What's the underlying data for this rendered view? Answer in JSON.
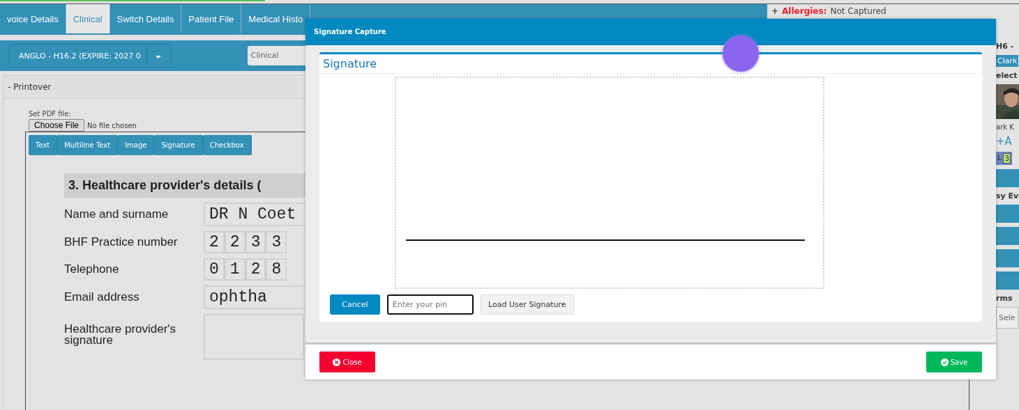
{
  "progress": {
    "level": 0.26
  },
  "tabs": [
    {
      "label": "voice Details",
      "selected": false
    },
    {
      "label": "Clinical",
      "selected": true
    },
    {
      "label": "Switch Details",
      "selected": false
    },
    {
      "label": "Patient File",
      "selected": false
    },
    {
      "label": "Medical Histo",
      "selected": false
    }
  ],
  "allergies": {
    "plus": "+",
    "label": "Allergies:",
    "value": "Not Captured"
  },
  "toolbar": {
    "scheme": "ANGLO - H16.2 (EXPIRE: 2027 0",
    "category": "Clinical"
  },
  "panel": {
    "title": "- Printover",
    "pdf_label": "Set PDF file:",
    "file_button": "Choose File",
    "file_status": "No file chosen",
    "tools": [
      "Text",
      "Multiline Text",
      "Image",
      "Signature",
      "Checkbox"
    ],
    "form": {
      "heading": "3. Healthcare provider's details (",
      "rows": [
        {
          "label": "Name and surname",
          "kind": "text",
          "value": "DR N Coet"
        },
        {
          "label": "BHF Practice number",
          "kind": "digits",
          "digits": [
            "2",
            "2",
            "3",
            "3"
          ]
        },
        {
          "label": "Telephone",
          "kind": "digits",
          "digits": [
            "0",
            "1",
            "2",
            "8"
          ]
        },
        {
          "label": "Email address",
          "kind": "text",
          "value": "ophtha"
        },
        {
          "label": "Healthcare provider's signature",
          "kind": "blank"
        }
      ]
    }
  },
  "side": [
    {
      "kind": "heading",
      "text": "H6 -"
    },
    {
      "kind": "badge",
      "text": "Clark"
    },
    {
      "kind": "heading",
      "text": "elect"
    },
    {
      "kind": "picture"
    },
    {
      "kind": "text",
      "text": "ark K"
    },
    {
      "kind": "link",
      "text": "+A"
    },
    {
      "kind": "tag",
      "text": "L",
      "count": "3"
    },
    {
      "kind": "bar"
    },
    {
      "kind": "heading",
      "text": "sy Ev"
    },
    {
      "kind": "bar"
    },
    {
      "kind": "bar"
    },
    {
      "kind": "bar"
    },
    {
      "kind": "bar"
    },
    {
      "kind": "heading",
      "text": "rms"
    },
    {
      "kind": "select",
      "text": "Sele"
    }
  ],
  "modal": {
    "title": "Signature Capture",
    "card_title": "Signature",
    "cancel": "Cancel",
    "pin_placeholder": "Enter your pin",
    "load": "Load User Signature",
    "close": "Close",
    "save": "Save"
  }
}
